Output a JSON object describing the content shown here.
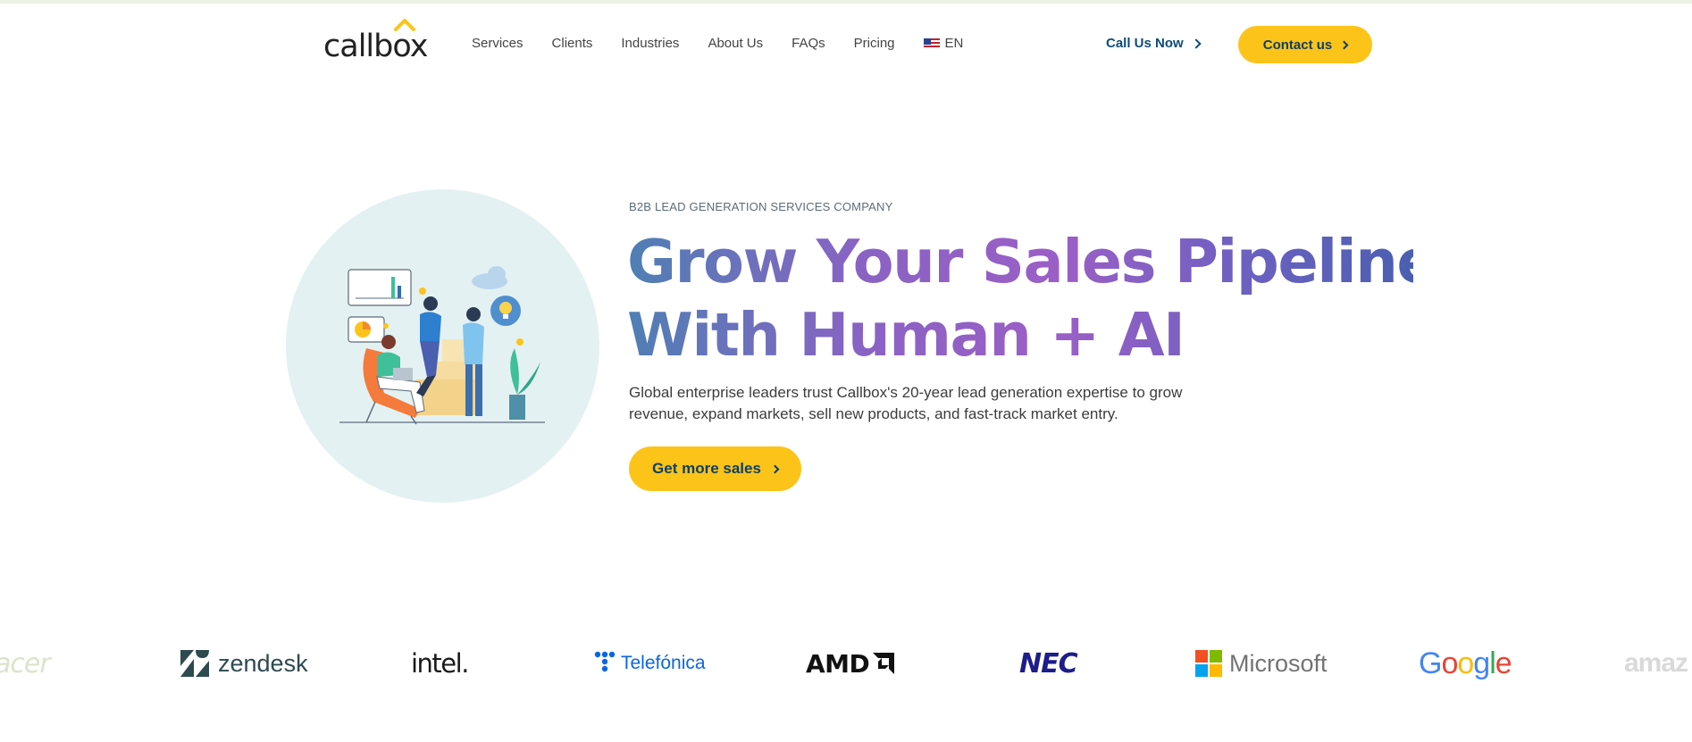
{
  "header": {
    "logo_text": "callbox",
    "nav": [
      "Services",
      "Clients",
      "Industries",
      "About Us",
      "FAQs",
      "Pricing"
    ],
    "language": "EN",
    "call_label": "Call Us Now",
    "contact_label": "Contact us"
  },
  "hero": {
    "eyebrow": "B2B LEAD GENERATION SERVICES COMPANY",
    "headline_line1": "Grow Your Sales Pipeline",
    "headline_line2": "With Human + AI",
    "subtext": "Global enterprise leaders trust Callbox's 20-year lead generation expertise to grow revenue, expand markets, sell new products, and fast-track market entry.",
    "cta_label": "Get more sales"
  },
  "client_logos": {
    "acer": "acer",
    "zendesk": "zendesk",
    "intel": "intel.",
    "telefonica": "Telefónica",
    "amd": "AMD",
    "nec": "NEC",
    "microsoft": "Microsoft",
    "google": [
      "G",
      "o",
      "o",
      "g",
      "l",
      "e"
    ],
    "amazon": "amaz"
  },
  "colors": {
    "accent_yellow": "#fcc419",
    "brand_navy": "#0e4c78",
    "gradient_blue": "#4f7fb4",
    "gradient_purple": "#9b5fc6",
    "hero_circle": "#e4f1f2"
  },
  "icons": [
    "flag-us-icon",
    "chevron-right-icon",
    "logo-caret-icon"
  ]
}
